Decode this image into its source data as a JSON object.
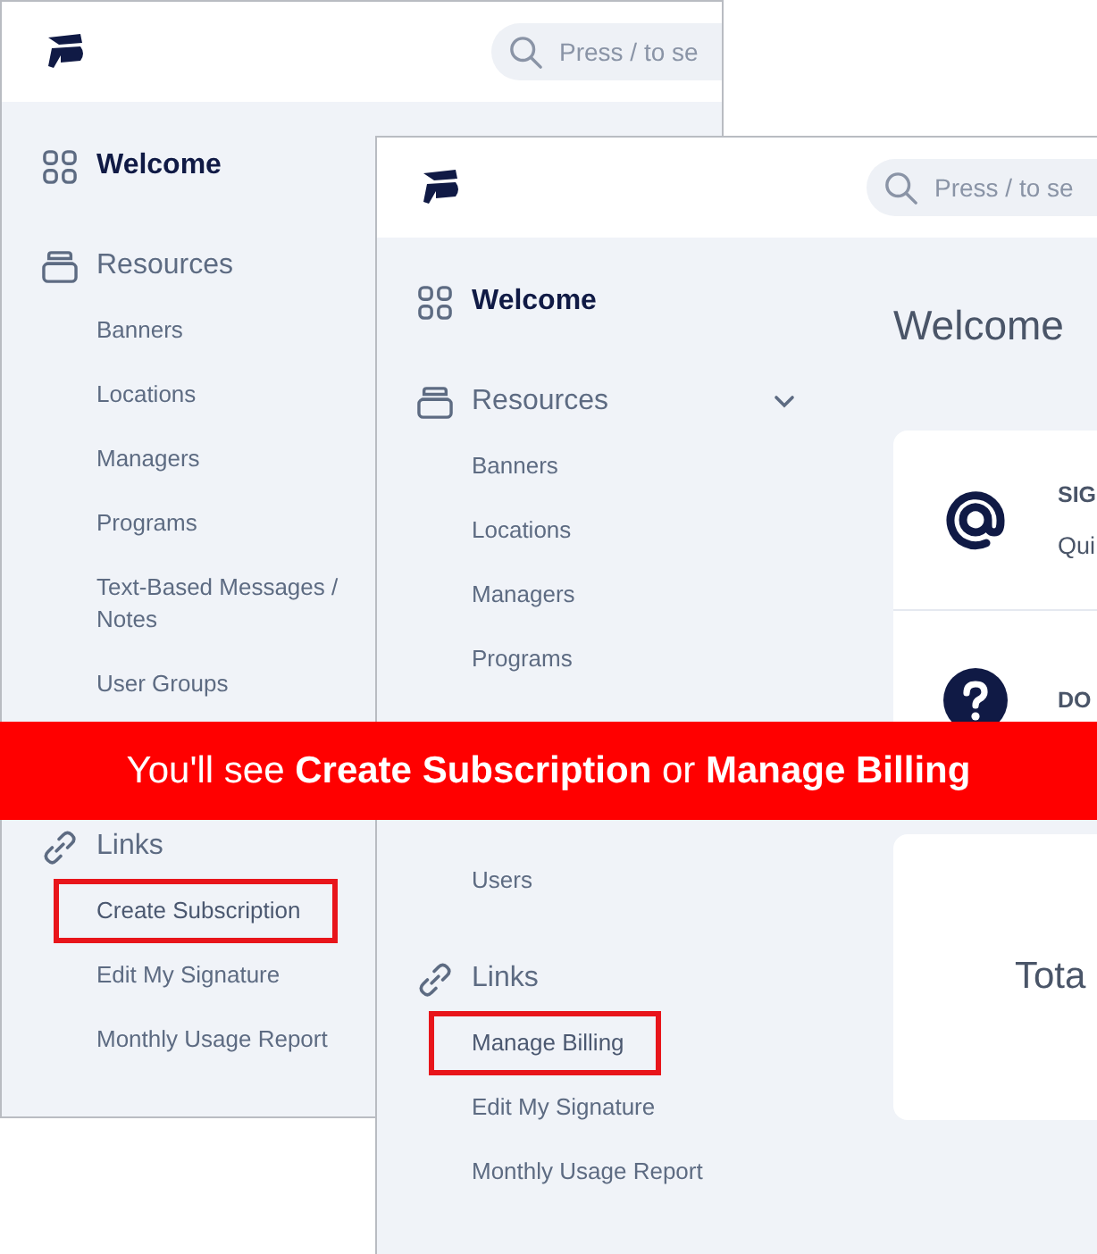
{
  "panels": [
    {
      "search": {
        "placeholder": "Press / to se"
      },
      "welcome": "Welcome",
      "groups": [
        {
          "kind": "resources",
          "label": "Resources",
          "items": [
            {
              "label": "Banners",
              "highlighted": false
            },
            {
              "label": "Locations",
              "highlighted": false
            },
            {
              "label": "Managers",
              "highlighted": false
            },
            {
              "label": "Programs",
              "highlighted": false
            },
            {
              "label": "Text-Based Messages / Notes",
              "highlighted": false
            },
            {
              "label": "User Groups",
              "highlighted": false
            }
          ]
        },
        {
          "kind": "links",
          "label": "Links",
          "items": [
            {
              "label": "Create Subscription",
              "highlighted": true
            },
            {
              "label": "Edit My Signature",
              "highlighted": false
            },
            {
              "label": "Monthly Usage Report",
              "highlighted": false
            }
          ]
        }
      ]
    },
    {
      "search": {
        "placeholder": "Press / to se"
      },
      "welcome": "Welcome",
      "groups": [
        {
          "kind": "resources",
          "label": "Resources",
          "expanded": true,
          "items": [
            {
              "label": "Banners",
              "highlighted": false
            },
            {
              "label": "Locations",
              "highlighted": false
            },
            {
              "label": "Managers",
              "highlighted": false
            },
            {
              "label": "Programs",
              "highlighted": false
            },
            {
              "label": "Users",
              "highlighted": false
            }
          ]
        },
        {
          "kind": "links",
          "label": "Links",
          "items": [
            {
              "label": "Manage Billing",
              "highlighted": true
            },
            {
              "label": "Edit My Signature",
              "highlighted": false
            },
            {
              "label": "Monthly Usage Report",
              "highlighted": false
            }
          ]
        }
      ],
      "main": {
        "title": "Welcome",
        "cards": [
          {
            "rows": [
              {
                "kind": "at",
                "heading": "SIG",
                "text": "Qui"
              },
              {
                "kind": "help",
                "heading": "DO"
              }
            ]
          },
          {
            "rows": [
              {
                "kind": "total",
                "text": "Tota"
              }
            ]
          }
        ]
      }
    }
  ],
  "banner": "You'll see **Create Subscription** or **Manage Billing**"
}
